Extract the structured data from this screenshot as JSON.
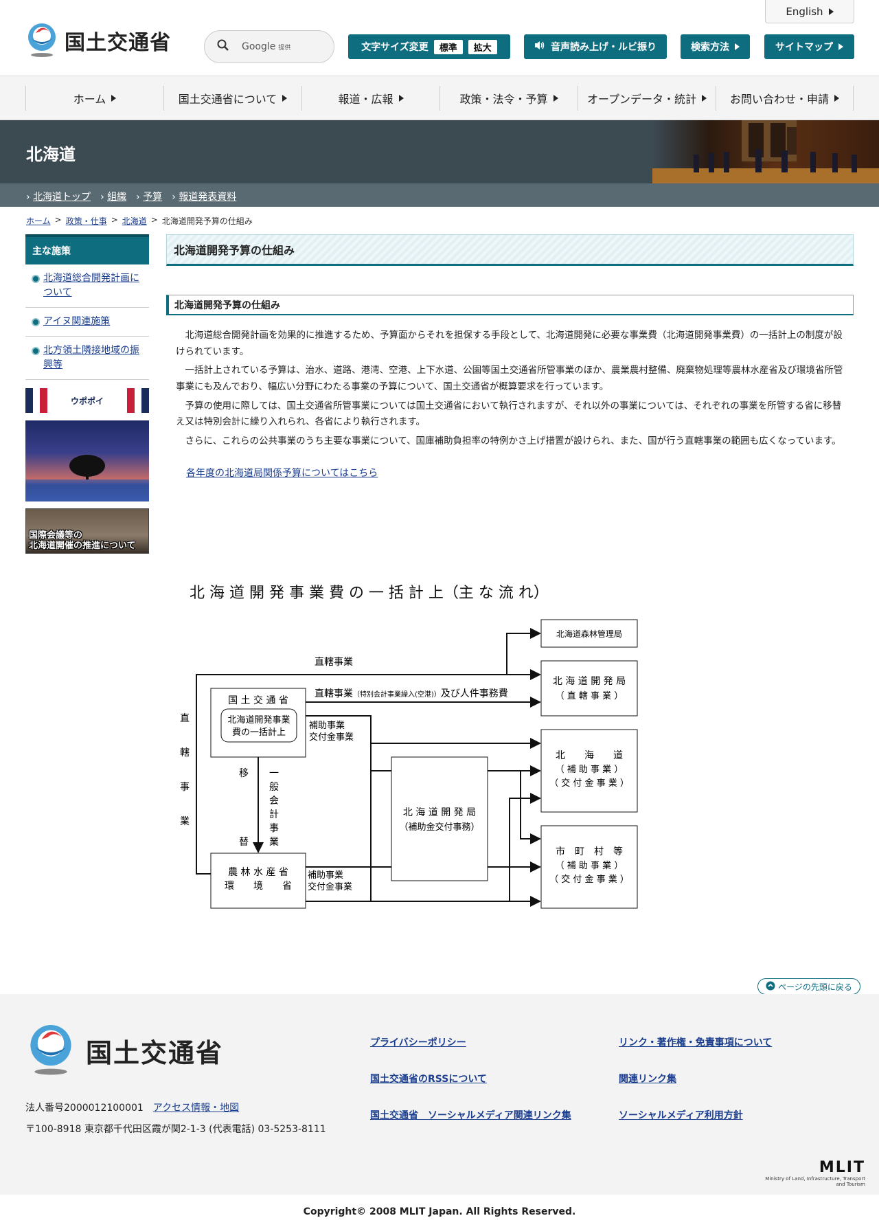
{
  "header": {
    "site_name": "国土交通省",
    "english": "English",
    "search": {
      "placeholder": "Google",
      "provider": "提供"
    },
    "font_size": {
      "label": "文字サイズ変更",
      "standard": "標準",
      "large": "拡大"
    },
    "read_aloud": "音声読み上げ・ルビ振り",
    "search_method": "検索方法",
    "sitemap": "サイトマップ",
    "brand_color": "#0f6d80"
  },
  "gnav": [
    {
      "label": "ホーム"
    },
    {
      "label": "国土交通省について"
    },
    {
      "label": "報道・広報"
    },
    {
      "label": "政策・法令・予算"
    },
    {
      "label": "オープンデータ・統計"
    },
    {
      "label": "お問い合わせ・申請"
    }
  ],
  "banner": {
    "title": "北海道",
    "subnav": [
      "北海道トップ",
      "組織",
      "予算",
      "報道発表資料"
    ]
  },
  "breadcrumb": {
    "items": [
      "ホーム",
      "政策・仕事",
      "北海道"
    ],
    "current": "北海道開発予算の仕組み",
    "separator": ">"
  },
  "sidebar": {
    "heading": "主な施策",
    "items": [
      {
        "label": "北海道総合開発計画について"
      },
      {
        "label": "アイヌ関連施策"
      },
      {
        "label": "北方領土隣接地域の振興等"
      }
    ],
    "banner_upopoy": "ウポポイ",
    "banner_conference": "国際会議等の\n北海道開催の推進について"
  },
  "main": {
    "title": "北海道開発予算の仕組み",
    "section_title": "北海道開発予算の仕組み",
    "paragraphs": [
      "北海道総合開発計画を効果的に推進するため、予算面からそれを担保する手段として、北海道開発に必要な事業費（北海道開発事業費）の一括計上の制度が設けられています。",
      "一括計上されている予算は、治水、道路、港湾、空港、上下水道、公園等国土交通省所管事業のほか、農業農村整備、廃棄物処理等農林水産省及び環境省所管事業にも及んでおり、幅広い分野にわたる事業の予算について、国土交通省が概算要求を行っています。",
      "予算の使用に際しては、国土交通省所管事業については国土交通省において執行されますが、それ以外の事業については、それぞれの事業を所管する省に移替え又は特別会計に繰り入れられ、各省により執行されます。",
      "さらに、これらの公共事業のうち主要な事業について、国庫補助負担率の特例かさ上げ措置が設けられ、また、国が行う直轄事業の範囲も広くなっています。"
    ],
    "link": "各年度の北海道局関係予算についてはこちら"
  },
  "diagram": {
    "title": "北 海 道 開 発 事 業 費 の 一 括 計 上（主 な 流 れ）",
    "boxes": {
      "forest": "北海道森林管理局",
      "bureau_direct_1": "北 海 道 開 発 局",
      "bureau_direct_2": "（ 直 轄 事 業 ）",
      "mlit_1": "国 土 交 通 省",
      "mlit_2": "北海道開発事業",
      "mlit_3": "費の一括計上",
      "bureau_subsidy_1": "北 海 道 開 発 局",
      "bureau_subsidy_2": "（補助金交付事務）",
      "hokkaido_1": "北　　海　　道",
      "hokkaido_2": "（ 補 助 事 業 ）",
      "hokkaido_3": "（ 交 付 金 事 業 ）",
      "muni_1": "市　町　村　等",
      "muni_2": "（ 補 助 事 業 ）",
      "muni_3": "（ 交 付 金 事 業 ）",
      "maff_1": "農 林 水 産 省",
      "maff_2": "環　　境　　省"
    },
    "labels": {
      "direct": "直轄事業",
      "direct_special_a": "直轄事業",
      "direct_special_b": "（特別会計事業繰入(空港)）",
      "direct_special_c": "及び人件事務費",
      "subsidy_1": "補助事業",
      "subsidy_2": "交付金事業",
      "subsidy_low_1": "補助事業",
      "subsidy_low_2": "交付金事業",
      "direct_vertical": [
        "直",
        "轄",
        "事",
        "業"
      ],
      "transfer": [
        "移",
        "替"
      ],
      "general_account": [
        "一",
        "般",
        "会",
        "計",
        "事",
        "業"
      ]
    }
  },
  "footer": {
    "site_name": "国土交通省",
    "corp_number": "法人番号2000012100001",
    "access": "アクセス情報・地図",
    "address": "〒100-8918 東京都千代田区霞が関2-1-3 (代表電話) 03-5253-8111",
    "links": [
      "プライバシーポリシー",
      "リンク・著作権・免責事項について",
      "国土交通省のRSSについて",
      "関連リンク集",
      "国土交通省　ソーシャルメディア関連リンク集",
      "ソーシャルメディア利用方針"
    ],
    "page_top": "ページの先頭に戻る",
    "mlit": "MLIT",
    "mlit_sub": "Ministry of Land, Infrastructure, Transport and Tourism",
    "copyright": "Copyright© 2008 MLIT Japan. All Rights Reserved."
  }
}
